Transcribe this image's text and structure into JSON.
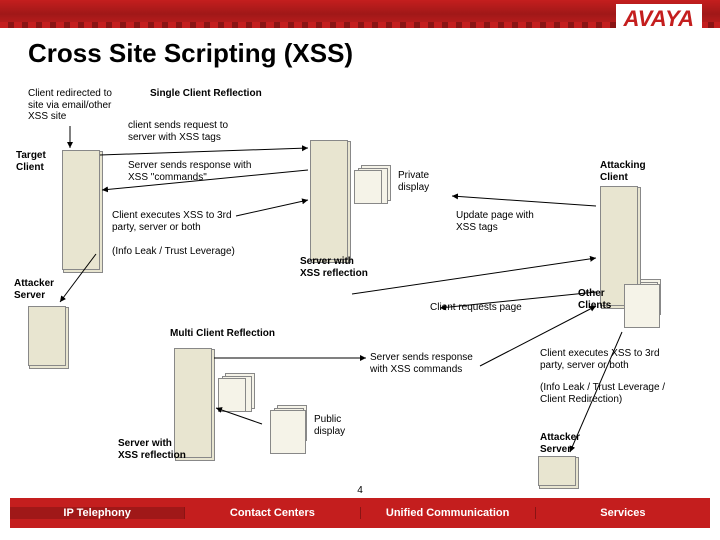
{
  "brand": "AVAYA",
  "title": "Cross Site Scripting (XSS)",
  "labels": {
    "redirect": "Client redirected to\nsite via email/other\nXSS site",
    "single": "Single Client Reflection",
    "req": "client sends request to\nserver with XSS tags",
    "target": "Target\nClient",
    "resp": "Server sends response with\nXSS \"commands\"",
    "private": "Private\ndisplay",
    "attacking": "Attacking\nClient",
    "exec1": "Client executes XSS to 3rd\nparty, server or both",
    "update": "Update page with\nXSS tags",
    "leak1": "(Info Leak / Trust Leverage)",
    "attacker_srv1": "Attacker\nServer",
    "srv_xss1": "Server with\nXSS reflection",
    "reqpage": "Client requests page",
    "other": "Other\nClients",
    "multi": "Multi Client Reflection",
    "resp2": "Server sends response\nwith XSS commands",
    "exec2": "Client executes XSS to 3rd\nparty, server or both",
    "leak2": "(Info Leak / Trust Leverage /\nClient Redirection)",
    "srv_xss2": "Server with\nXSS reflection",
    "public": "Public\ndisplay",
    "attacker_srv2": "Attacker\nServer"
  },
  "footer": [
    "IP Telephony",
    "Contact Centers",
    "Unified Communication",
    "Services"
  ],
  "pagenum": "4"
}
